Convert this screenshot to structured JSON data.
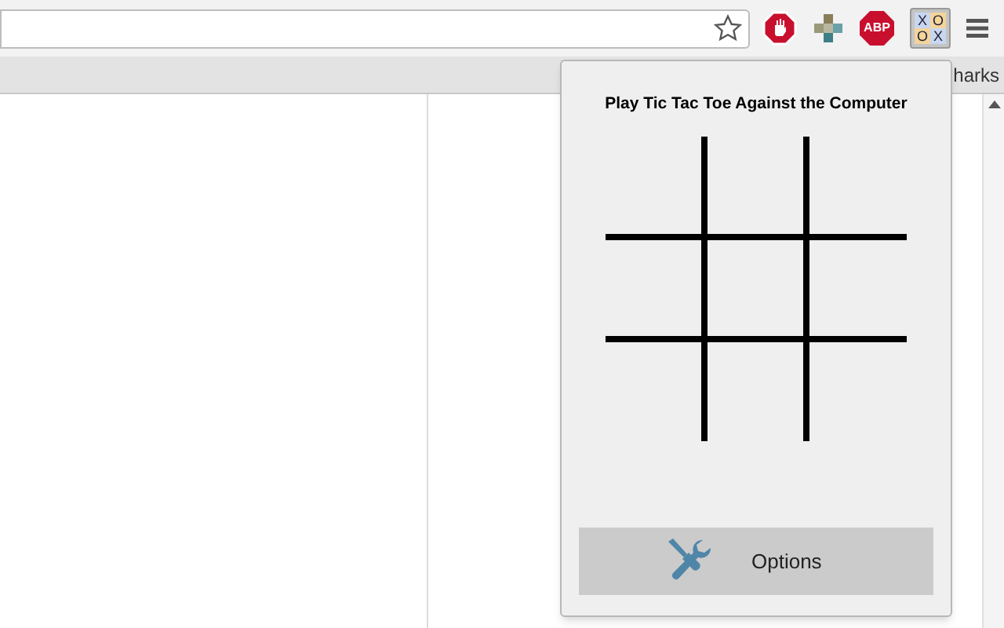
{
  "toolbar": {
    "extensions": [
      {
        "kind": "stop"
      },
      {
        "kind": "puzzle"
      },
      {
        "kind": "abp",
        "label": "ABP"
      },
      {
        "kind": "tictactoe",
        "selected": true,
        "letters": [
          "X",
          "O",
          "O",
          "X"
        ]
      }
    ]
  },
  "bookmarks_bar": {
    "visible_text": "harks"
  },
  "popup": {
    "title": "Play Tic Tac Toe Against the Computer",
    "options_button": "Options"
  }
}
